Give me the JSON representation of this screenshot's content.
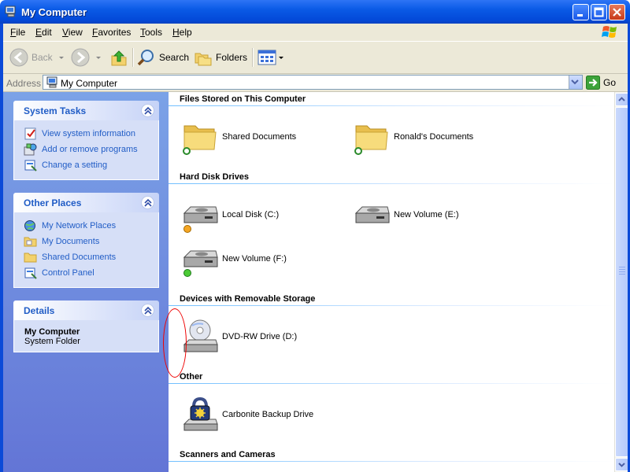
{
  "window": {
    "title": "My Computer"
  },
  "menu": {
    "items": [
      "File",
      "Edit",
      "View",
      "Favorites",
      "Tools",
      "Help"
    ]
  },
  "toolbar": {
    "back": "Back",
    "search": "Search",
    "folders": "Folders"
  },
  "address": {
    "label": "Address",
    "value": "My Computer",
    "go": "Go"
  },
  "system_tasks": {
    "title": "System Tasks",
    "links": [
      "View system information",
      "Add or remove programs",
      "Change a setting"
    ]
  },
  "other_places": {
    "title": "Other Places",
    "links": [
      "My Network Places",
      "My Documents",
      "Shared Documents",
      "Control Panel"
    ]
  },
  "details": {
    "title": "Details",
    "name": "My Computer",
    "type": "System Folder"
  },
  "groups": {
    "files": {
      "title": "Files Stored on This Computer",
      "items": [
        "Shared Documents",
        "Ronald's Documents"
      ]
    },
    "hdd": {
      "title": "Hard Disk Drives",
      "items": [
        "Local Disk (C:)",
        "New Volume (E:)",
        "New Volume (F:)"
      ]
    },
    "removable": {
      "title": "Devices with Removable Storage",
      "items": [
        "DVD-RW Drive (D:)"
      ]
    },
    "other": {
      "title": "Other",
      "items": [
        "Carbonite Backup Drive"
      ]
    },
    "scanners": {
      "title": "Scanners and Cameras"
    }
  },
  "colors": {
    "title_bar": "#0a5ae6",
    "task_link": "#215dc6",
    "left_pane": "#7ba2e7"
  }
}
